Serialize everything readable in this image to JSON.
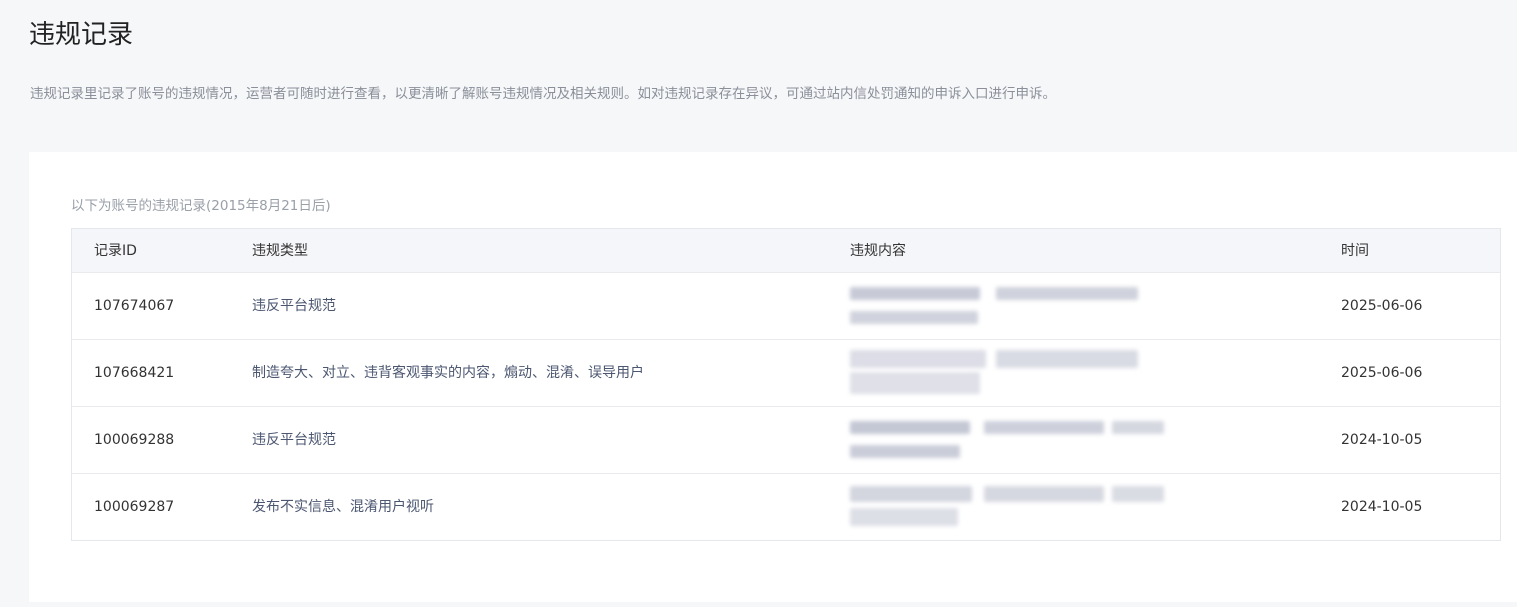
{
  "page": {
    "title": "违规记录",
    "description": "违规记录里记录了账号的违规情况，运营者可随时进行查看，以更清晰了解账号违规情况及相关规则。如对违规记录存在异议，可通过站内信处罚通知的申诉入口进行申诉。"
  },
  "card": {
    "subtitle": "以下为账号的违规记录(2015年8月21日后)"
  },
  "table": {
    "headers": {
      "id": "记录ID",
      "type": "违规类型",
      "content": "违规内容",
      "time": "时间"
    },
    "rows": [
      {
        "id": "107674067",
        "type": "违反平台规范",
        "time": "2025-06-06"
      },
      {
        "id": "107668421",
        "type": "制造夸大、对立、违背客观事实的内容，煽动、混淆、误导用户",
        "time": "2025-06-06"
      },
      {
        "id": "100069288",
        "type": "违反平台规范",
        "time": "2024-10-05"
      },
      {
        "id": "100069287",
        "type": "发布不实信息、混淆用户视听",
        "time": "2024-10-05"
      }
    ]
  }
}
